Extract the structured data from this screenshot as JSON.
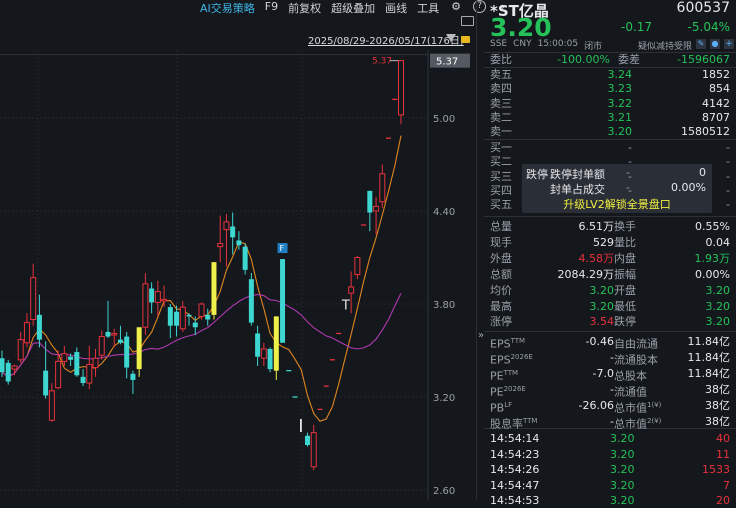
{
  "toolbar": {
    "ai": "AI交易策略",
    "f9": "F9",
    "adjust": "前复权",
    "overlay": "超级叠加",
    "draw": "画线",
    "tools": "工具",
    "icons": [
      "gear-icon",
      "help-icon",
      "chevron-right-icon",
      "monitor-icon",
      "lock-icon"
    ]
  },
  "range": "2025/08/29-2026/05/17(176日)",
  "price_axis": {
    "ticks": [
      "5.00",
      "4.40",
      "3.80",
      "3.20",
      "2.60"
    ],
    "current": "5.37",
    "max_label": "5.37"
  },
  "colors": {
    "up": "#e8323c",
    "down": "#3ed6d0",
    "highlight": "#f0f04a",
    "ma_short": "#e0861e",
    "ma_long": "#b03ab0",
    "green": "#25c25a"
  },
  "chart_data": {
    "type": "candlestick",
    "ylim": [
      2.6,
      5.37
    ],
    "yticks": [
      5.0,
      4.4,
      3.8,
      3.2,
      2.6
    ],
    "grid": true,
    "candles": [
      [
        3.45,
        3.5,
        3.33,
        3.36,
        "d"
      ],
      [
        3.42,
        3.44,
        3.28,
        3.3,
        "d"
      ],
      [
        3.38,
        3.41,
        3.34,
        3.4,
        "u"
      ],
      [
        3.44,
        3.62,
        3.42,
        3.57,
        "u"
      ],
      [
        3.55,
        3.74,
        3.52,
        3.68,
        "u"
      ],
      [
        3.7,
        4.06,
        3.66,
        3.97,
        "u"
      ],
      [
        3.73,
        3.86,
        3.52,
        3.57,
        "d"
      ],
      [
        3.37,
        3.56,
        3.19,
        3.21,
        "d"
      ],
      [
        3.05,
        3.29,
        3.04,
        3.24,
        "u"
      ],
      [
        3.26,
        3.5,
        3.25,
        3.43,
        "u"
      ],
      [
        3.43,
        3.53,
        3.4,
        3.48,
        "u"
      ],
      [
        3.46,
        3.48,
        3.4,
        3.44,
        "d"
      ],
      [
        3.49,
        3.52,
        3.33,
        3.34,
        "d"
      ],
      [
        3.33,
        3.38,
        3.27,
        3.29,
        "d"
      ],
      [
        3.29,
        3.53,
        3.25,
        3.41,
        "u"
      ],
      [
        3.39,
        3.51,
        3.33,
        3.45,
        "u"
      ],
      [
        3.47,
        3.63,
        3.44,
        3.59,
        "u"
      ],
      [
        3.62,
        3.82,
        3.58,
        3.59,
        "d"
      ],
      [
        3.6,
        3.64,
        3.52,
        3.61,
        "u"
      ],
      [
        3.57,
        3.66,
        3.54,
        3.55,
        "d"
      ],
      [
        3.59,
        3.62,
        3.32,
        3.39,
        "d"
      ],
      [
        3.35,
        3.37,
        3.22,
        3.31,
        "d"
      ],
      [
        3.38,
        3.38,
        3.33,
        3.65,
        "y"
      ],
      [
        3.65,
        4.0,
        3.6,
        3.93,
        "u"
      ],
      [
        3.9,
        3.94,
        3.74,
        3.81,
        "d"
      ],
      [
        3.81,
        3.95,
        3.72,
        3.88,
        "u"
      ],
      [
        3.82,
        3.92,
        3.78,
        3.83,
        "u"
      ],
      [
        3.78,
        3.8,
        3.58,
        3.66,
        "d"
      ],
      [
        3.75,
        3.79,
        3.59,
        3.66,
        "d"
      ],
      [
        3.64,
        3.82,
        3.62,
        3.78,
        "u"
      ],
      [
        3.73,
        3.74,
        3.66,
        3.72,
        "d"
      ],
      [
        3.68,
        3.72,
        3.6,
        3.65,
        "d"
      ],
      [
        3.72,
        3.81,
        3.7,
        3.8,
        "u"
      ],
      [
        3.73,
        3.77,
        3.66,
        3.7,
        "d"
      ],
      [
        3.73,
        4.07,
        3.7,
        4.07,
        "y"
      ],
      [
        4.17,
        4.37,
        4.07,
        4.19,
        "u"
      ],
      [
        4.28,
        4.38,
        4.04,
        4.33,
        "u"
      ],
      [
        4.3,
        4.39,
        4.12,
        4.23,
        "d"
      ],
      [
        4.21,
        4.27,
        4.15,
        4.18,
        "d"
      ],
      [
        4.17,
        4.19,
        3.99,
        4.02,
        "d"
      ],
      [
        3.96,
        4.0,
        3.66,
        3.68,
        "d"
      ],
      [
        3.61,
        3.66,
        3.4,
        3.46,
        "d"
      ],
      [
        3.45,
        3.55,
        3.4,
        3.51,
        "u"
      ],
      [
        3.51,
        3.52,
        3.36,
        3.38,
        "d"
      ],
      [
        3.37,
        3.72,
        3.31,
        3.72,
        "y"
      ],
      [
        4.09,
        4.09,
        3.55,
        3.55,
        "d"
      ],
      [
        3.37,
        3.37,
        3.37,
        3.37,
        "d"
      ],
      [
        3.2,
        3.2,
        3.2,
        3.2,
        "d"
      ],
      [
        3.04,
        3.04,
        3.04,
        3.04,
        "n"
      ],
      [
        2.95,
        2.97,
        2.88,
        2.89,
        "d"
      ],
      [
        2.75,
        3.02,
        2.73,
        2.97,
        "u"
      ],
      [
        3.12,
        3.12,
        3.12,
        3.12,
        "u"
      ],
      [
        3.27,
        3.27,
        3.27,
        3.27,
        "u"
      ],
      [
        3.44,
        3.44,
        3.44,
        3.44,
        "u"
      ],
      [
        3.61,
        3.61,
        3.61,
        3.61,
        "u"
      ],
      [
        3.79,
        3.79,
        3.79,
        3.79,
        "n"
      ],
      [
        3.87,
        4.01,
        3.74,
        3.91,
        "u"
      ],
      [
        3.99,
        4.11,
        3.96,
        4.1,
        "u"
      ],
      [
        4.31,
        4.31,
        4.31,
        4.31,
        "u"
      ],
      [
        4.53,
        4.53,
        4.27,
        4.39,
        "d"
      ],
      [
        4.4,
        4.49,
        4.25,
        4.43,
        "u"
      ],
      [
        4.46,
        4.7,
        4.42,
        4.64,
        "u"
      ],
      [
        4.87,
        4.87,
        4.87,
        4.87,
        "u"
      ],
      [
        5.12,
        5.12,
        5.12,
        5.12,
        "u"
      ],
      [
        5.02,
        5.37,
        4.96,
        5.37,
        "u"
      ]
    ],
    "markers": [
      {
        "index": 45,
        "label": "F"
      },
      {
        "index": 48,
        "label": "I"
      },
      {
        "index": 55,
        "label": "T"
      }
    ]
  },
  "quote": {
    "name": "*ST亿晶",
    "code": "600537",
    "price": "3.20",
    "change": "-0.17",
    "pct": "-5.04%",
    "exchange": "SSE",
    "currency": "CNY",
    "time": "15:00:05",
    "status": "闭市",
    "tag": "疑似减持受限"
  },
  "order_book": {
    "ratio_label": "委比",
    "ratio": "-100.00%",
    "diff_label": "委差",
    "diff": "-1596067",
    "asks": [
      {
        "label": "卖五",
        "price": "3.24",
        "vol": "1852"
      },
      {
        "label": "卖四",
        "price": "3.23",
        "vol": "854"
      },
      {
        "label": "卖三",
        "price": "3.22",
        "vol": "4142"
      },
      {
        "label": "卖二",
        "price": "3.21",
        "vol": "8707"
      },
      {
        "label": "卖一",
        "price": "3.20",
        "vol": "1580512"
      }
    ],
    "bids": [
      {
        "label": "买一",
        "price": "-",
        "vol": "-"
      },
      {
        "label": "买二",
        "price": "-",
        "vol": "-"
      },
      {
        "label": "买三",
        "price": "-",
        "vol": "-"
      },
      {
        "label": "买四",
        "price": "-",
        "vol": "-"
      },
      {
        "label": "买五",
        "price": "-",
        "vol": "-"
      }
    ],
    "overlay": {
      "tag": "跌停",
      "seal_label": "跌停封单额",
      "seal_value": "0",
      "ratio_label": "封单占成交",
      "ratio_value": "0.00%",
      "dash": "-",
      "upgrade": "升级LV2解锁全景盘口"
    }
  },
  "stats": [
    {
      "l1": "总量",
      "v1": "6.51万",
      "c1": "w",
      "l2": "换手",
      "v2": "0.55%",
      "c2": "w"
    },
    {
      "l1": "现手",
      "v1": "529",
      "c1": "w",
      "l2": "量比",
      "v2": "0.04",
      "c2": "w"
    },
    {
      "l1": "外盘",
      "v1": "4.58万",
      "c1": "r",
      "l2": "内盘",
      "v2": "1.93万",
      "c2": "g"
    },
    {
      "l1": "总额",
      "v1": "2084.29万",
      "c1": "w",
      "l2": "振幅",
      "v2": "0.00%",
      "c2": "w"
    },
    {
      "l1": "均价",
      "v1": "3.20",
      "c1": "g",
      "l2": "开盘",
      "v2": "3.20",
      "c2": "g"
    },
    {
      "l1": "最高",
      "v1": "3.20",
      "c1": "g",
      "l2": "最低",
      "v2": "3.20",
      "c2": "g"
    },
    {
      "l1": "涨停",
      "v1": "3.54",
      "c1": "r",
      "l2": "跌停",
      "v2": "3.20",
      "c2": "g"
    }
  ],
  "fundamentals": [
    {
      "l1": "EPS",
      "s1": "TTM",
      "v1": "-0.46",
      "l2": "自由流通",
      "s2": "",
      "v2": "11.84亿"
    },
    {
      "l1": "EPS",
      "s1": "2026E",
      "v1": "-",
      "l2": "流通股本",
      "s2": "",
      "v2": "11.84亿"
    },
    {
      "l1": "PE",
      "s1": "TTM",
      "v1": "-7.0",
      "l2": "总股本",
      "s2": "",
      "v2": "11.84亿"
    },
    {
      "l1": "PE",
      "s1": "2026E",
      "v1": "-",
      "l2": "流通值",
      "s2": "",
      "v2": "38亿"
    },
    {
      "l1": "PB",
      "s1": "LF",
      "v1": "-26.06",
      "l2": "总市值",
      "s2": "1(¥)",
      "v2": "38亿"
    },
    {
      "l1": "股息率",
      "s1": "TTM",
      "v1": "-",
      "l2": "总市值",
      "s2": "2(¥)",
      "v2": "38亿"
    }
  ],
  "ticks": [
    {
      "time": "14:54:14",
      "price": "3.20",
      "vol": "40"
    },
    {
      "time": "14:54:23",
      "price": "3.20",
      "vol": "11"
    },
    {
      "time": "14:54:26",
      "price": "3.20",
      "vol": "1533"
    },
    {
      "time": "14:54:47",
      "price": "3.20",
      "vol": "7"
    },
    {
      "time": "14:54:53",
      "price": "3.20",
      "vol": "20"
    }
  ],
  "collapse": "»"
}
